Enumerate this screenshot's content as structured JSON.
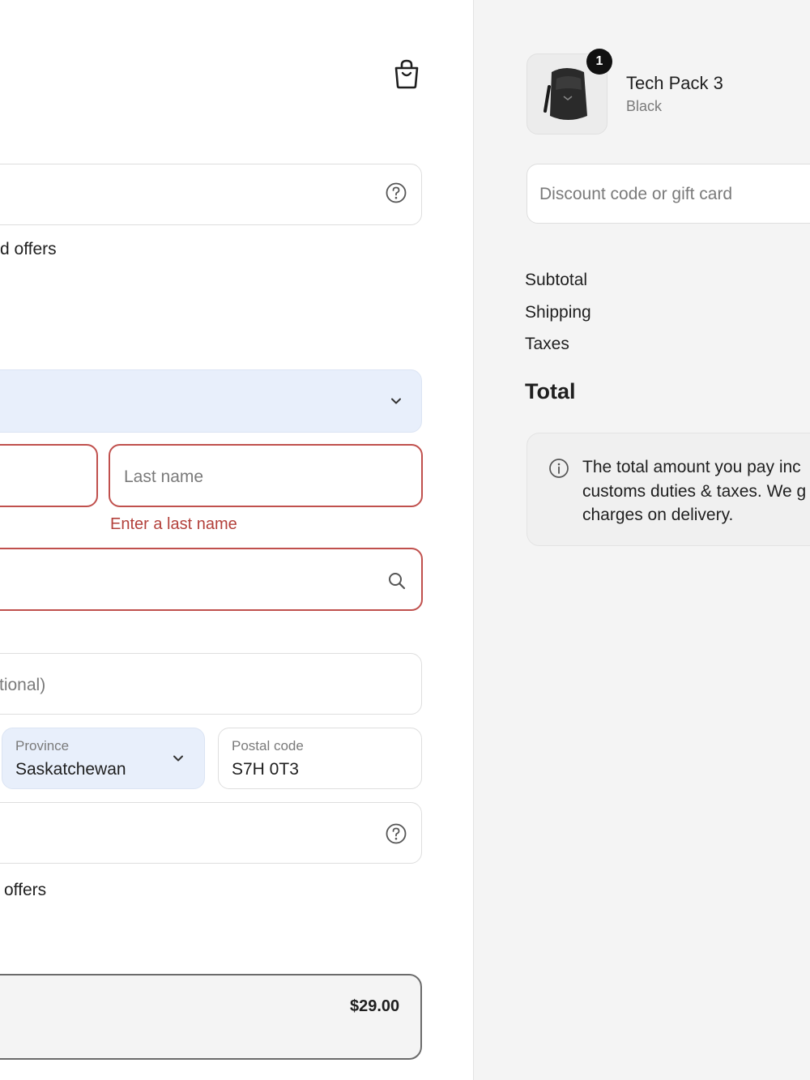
{
  "contact": {
    "marketing_optin_text": "d offers"
  },
  "delivery": {
    "last_name_placeholder": "Last name",
    "last_name_error": "Enter a last name",
    "apartment_placeholder": "tional)",
    "province_label": "Province",
    "province_value": "Saskatchewan",
    "postal_label": "Postal code",
    "postal_value": "S7H 0T3",
    "sms_optin_text": "offers"
  },
  "shipping": {
    "price": "$29.00"
  },
  "cart": {
    "item_name": "Tech Pack 3",
    "item_variant": "Black",
    "item_quantity": "1"
  },
  "summary": {
    "discount_placeholder": "Discount code or gift card",
    "subtotal_label": "Subtotal",
    "shipping_label": "Shipping",
    "taxes_label": "Taxes",
    "total_label": "Total",
    "notice_line1": "The total amount you pay inc",
    "notice_line2": "customs duties & taxes. We g",
    "notice_line3": "charges on delivery."
  },
  "icons": {
    "bag": "shopping-bag-icon",
    "help": "question-circle-icon",
    "search": "search-icon",
    "chevron": "chevron-down-icon",
    "info": "info-circle-icon"
  },
  "colors": {
    "error": "#c0504d",
    "select_bg": "#e8effb",
    "summary_bg": "#f4f4f4"
  }
}
